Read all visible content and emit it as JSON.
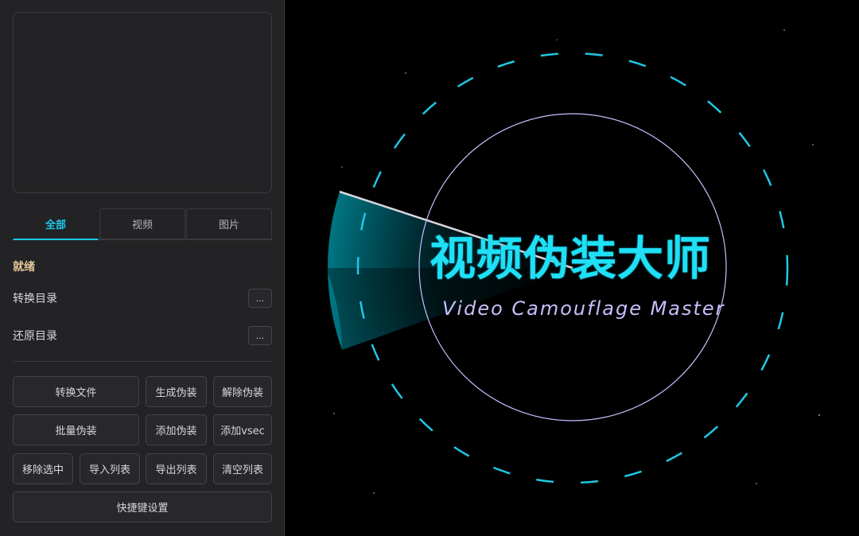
{
  "tabs": [
    {
      "label": "全部",
      "active": true
    },
    {
      "label": "视频",
      "active": false
    },
    {
      "label": "图片",
      "active": false
    }
  ],
  "status": "就绪",
  "convert_dir": {
    "label": "转换目录",
    "button": "..."
  },
  "restore_dir": {
    "label": "还原目录",
    "button": "..."
  },
  "buttons": {
    "convert_file": "转换文件",
    "generate": "生成伪装",
    "remove_camo": "解除伪装",
    "batch": "批量伪装",
    "add_camo": "添加伪装",
    "add_vsec": "添加vsec",
    "remove_selected": "移除选中",
    "import_list": "导入列表",
    "export_list": "导出列表",
    "clear_list": "清空列表",
    "shortcuts": "快捷键设置"
  },
  "splash": {
    "title": "视频伪装大师",
    "subtitle": "Video Camouflage Master",
    "accent": "#1fe0f5",
    "ring": "#c8bfff"
  }
}
